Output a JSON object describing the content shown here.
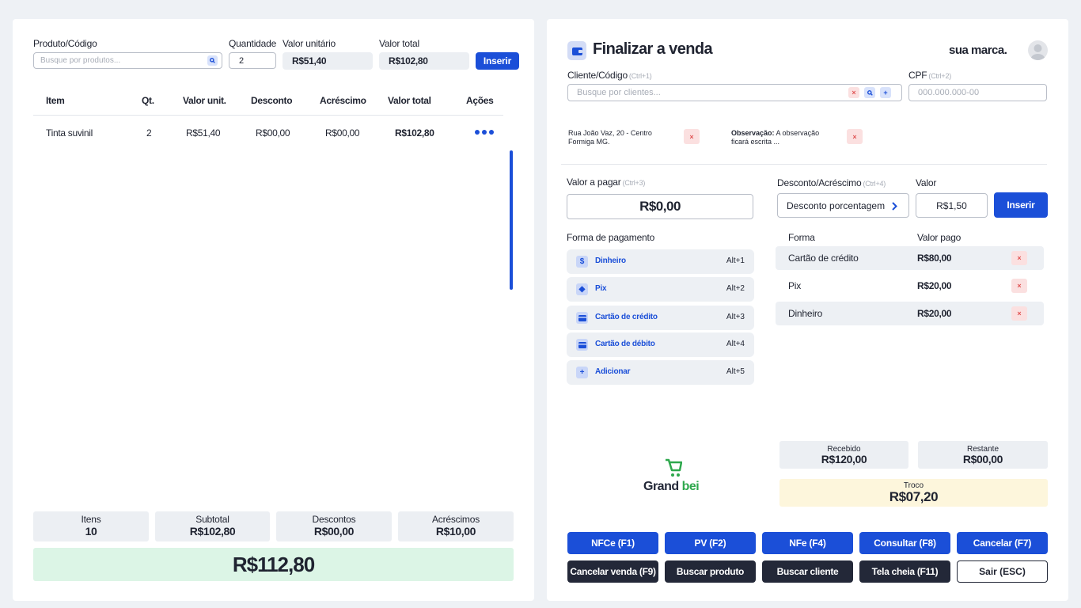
{
  "left": {
    "product_label": "Produto/Código",
    "product_placeholder": "Busque por produtos...",
    "qty_label": "Quantidade",
    "qty_value": "2",
    "unit_label": "Valor unitário",
    "unit_value": "R$51,40",
    "total_label": "Valor total",
    "total_value": "R$102,80",
    "insert_label": "Inserir",
    "table": {
      "headers": [
        "Item",
        "Qt.",
        "Valor unit.",
        "Desconto",
        "Acréscimo",
        "Valor total",
        "Ações"
      ],
      "rows": [
        {
          "item": "Tinta suvinil",
          "qt": "2",
          "unit": "R$51,40",
          "discount": "R$00,00",
          "addition": "R$00,00",
          "total": "R$102,80"
        }
      ]
    },
    "summary": [
      {
        "title": "Itens",
        "value": "10"
      },
      {
        "title": "Subtotal",
        "value": "R$102,80"
      },
      {
        "title": "Descontos",
        "value": "R$00,00"
      },
      {
        "title": "Acréscimos",
        "value": "R$10,00"
      }
    ],
    "grand_total": "R$112,80"
  },
  "right": {
    "title": "Finalizar a venda",
    "brand": "sua marca.",
    "client_label": "Cliente/Código",
    "client_hint": "(Ctrl+1)",
    "client_placeholder": "Busque por clientes...",
    "cpf_label": "CPF",
    "cpf_hint": "(Ctrl+2)",
    "cpf_placeholder": "000.000.000-00",
    "address": "Rua João Vaz, 20 - Centro Formiga MG.",
    "observation_label": "Observação:",
    "observation_text": "A observação ficará escrita ...",
    "pay_value_label": "Valor a pagar",
    "pay_value_hint": "(Ctrl+3)",
    "pay_value": "R$0,00",
    "discount_label": "Desconto/Acréscimo",
    "discount_hint": "(Ctrl+4)",
    "discount_option": "Desconto porcentagem",
    "value_label": "Valor",
    "value_value": "R$1,50",
    "insert_label": "Inserir",
    "payment_methods_label": "Forma de pagamento",
    "payment_methods": [
      {
        "name": "Dinheiro",
        "shortcut": "Alt+1",
        "icon": "cash-icon"
      },
      {
        "name": "Pix",
        "shortcut": "Alt+2",
        "icon": "pix-icon"
      },
      {
        "name": "Cartão de crédito",
        "shortcut": "Alt+3",
        "icon": "credit-card-icon"
      },
      {
        "name": "Cartão de débito",
        "shortcut": "Alt+4",
        "icon": "debit-card-icon"
      },
      {
        "name": "Adicionar",
        "shortcut": "Alt+5",
        "icon": "plus-icon"
      }
    ],
    "payments_headers": [
      "Forma",
      "Valor pago"
    ],
    "payments": [
      {
        "method": "Cartão de crédito",
        "value": "R$80,00"
      },
      {
        "method": "Pix",
        "value": "R$20,00"
      },
      {
        "method": "Dinheiro",
        "value": "R$20,00"
      }
    ],
    "logo_text_1": "Grand",
    "logo_text_2": "bei",
    "received_label": "Recebido",
    "received_value": "R$120,00",
    "remaining_label": "Restante",
    "remaining_value": "R$00,00",
    "change_label": "Troco",
    "change_value": "R$07,20",
    "buttons_row1": [
      "NFCe (F1)",
      "PV (F2)",
      "NFe (F4)",
      "Consultar (F8)",
      "Cancelar (F7)"
    ],
    "buttons_row2": [
      "Cancelar venda (F9)",
      "Buscar produto",
      "Buscar cliente",
      "Tela cheia (F11)",
      "Sair (ESC)"
    ]
  },
  "colors": {
    "accent": "#1b4fd8",
    "dark": "#232838",
    "total_bg": "#dcf5e6",
    "change_bg": "#fdf6dc",
    "logo_green": "#2ea84d"
  }
}
